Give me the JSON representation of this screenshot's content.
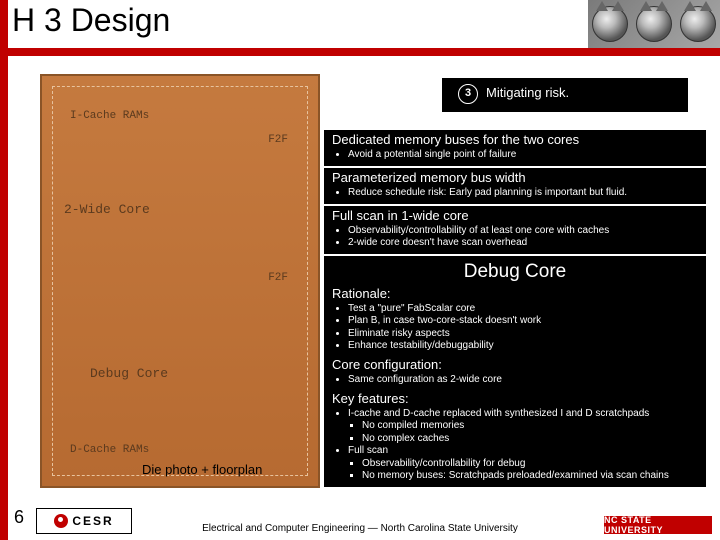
{
  "title": "H 3 Design",
  "wolves_alt": "NC State wolves imagery",
  "mitigating": {
    "number": "3",
    "label": "Mitigating risk."
  },
  "panels": {
    "dedicated": {
      "heading": "Dedicated memory buses for the two cores",
      "b1": "Avoid a potential single point of failure"
    },
    "param": {
      "heading": "Parameterized memory bus width",
      "b1": "Reduce schedule risk: Early pad planning is important but fluid."
    },
    "scan": {
      "heading": "Full scan in 1-wide core",
      "b1": "Observability/controllability of at least one core with caches",
      "b2": "2-wide core doesn't have scan overhead"
    },
    "debug": {
      "title": "Debug Core",
      "rationale_h": "Rationale:",
      "r1": "Test a \"pure\" FabScalar core",
      "r2": "Plan B, in case two-core-stack doesn't work",
      "r3": "Eliminate risky aspects",
      "r4": "Enhance testability/debuggability",
      "config_h": "Core configuration:",
      "c1": "Same configuration as 2-wide core",
      "key_h": "Key features:",
      "k1": "I-cache and D-cache replaced with synthesized I and D scratchpads",
      "k1a": "No compiled memories",
      "k1b": "No complex caches",
      "k2": "Full scan",
      "k2a": "Observability/controllability for debug",
      "k2b": "No memory buses: Scratchpads preloaded/examined via scan chains"
    }
  },
  "die": {
    "icache": "I-Cache RAMs",
    "f2f_top": "F2F",
    "wide2": "2-Wide Core",
    "f2f_mid": "F2F",
    "debug": "Debug Core",
    "dcache": "D-Cache RAMs",
    "caption": "Die photo + floorplan"
  },
  "footer": {
    "page": "6",
    "cesr": "CESR",
    "dept": "Electrical and Computer Engineering — North Carolina State University",
    "ncsu": "NC STATE UNIVERSITY"
  }
}
